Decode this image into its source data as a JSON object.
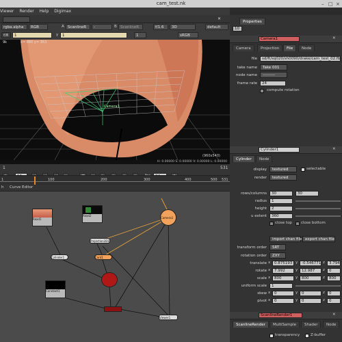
{
  "window": {
    "title": "cam_test.nk"
  },
  "menu": {
    "items": [
      "Viewer",
      "Render",
      "Help",
      "Digimax"
    ]
  },
  "viewer_toolbar": {
    "channels": "rgba.alpha",
    "colorspace": "RGB",
    "input_a": "A",
    "renderer_a": "ScanlineR",
    "dash": "-",
    "input_b": "B",
    "renderer_b": "ScanlineR",
    "gain": "f/1.6",
    "view_mode": "3D",
    "view_default": "default",
    "gamma_label": "y",
    "gamma_value": "1",
    "frame_box": "1",
    "lut": "sRGB"
  },
  "viewer": {
    "info": "x= 880 y= 363",
    "node_label": "Camera1",
    "resolution": "(960x540)",
    "readout": "H: 0.00000 S: 0.00000 V: 0.00000  L: 0.00000",
    "status_prefix": "9k"
  },
  "timeline": {
    "frame": "10",
    "fps_label": "fps",
    "fps": "24",
    "ticks": [
      "1",
      "100",
      "200",
      "300",
      "400",
      "500",
      "531"
    ],
    "start": "1",
    "end": "531"
  },
  "node_graph": {
    "tabs": [
      "h",
      "Curve Editor"
    ],
    "nodes": {
      "read1": "Read1",
      "read2": "Read2",
      "projection": "Projection3D1",
      "camera": "Camera1",
      "card": "Card1",
      "cylinder": "Cylinder1",
      "constant": "Constant1",
      "viewer1": "Viewer1",
      "scanline": "ScanlineRender1"
    }
  },
  "properties": {
    "title": "Properties",
    "count": "10",
    "camera": {
      "name": "Camera1",
      "tabs": [
        "Camera",
        "Projection",
        "File",
        "Node"
      ],
      "file_label": "file",
      "file_value": "sd/ft/sq020/sh0090/drake/cam_test_02.fbx",
      "take_name_label": "take name",
      "take_name": "Take 001",
      "node_name_label": "node name",
      "node_name": "---------",
      "frame_rate_label": "frame rate",
      "frame_rate": "24",
      "compute_rotation": "compute rotation"
    },
    "cylinder": {
      "name": "Cylinder1",
      "tabs": [
        "Cylinder",
        "Node"
      ],
      "display_label": "display",
      "display": "textured",
      "selectable": "selectable",
      "render_label": "render",
      "render": "textured",
      "rows_label": "rows/columns",
      "rows": "30",
      "columns": "30",
      "radius_label": "radius",
      "radius": "1",
      "height_label": "height",
      "height": "2",
      "u_extent_label": "u extent",
      "u_extent": "360",
      "close_top": "close top",
      "close_bottom": "close bottom",
      "import_chan": "import chan file",
      "export_chan": "export chan file",
      "transform_order_label": "transform order",
      "transform_order": "SRT",
      "rotation_order_label": "rotation order",
      "rotation_order": "ZXY",
      "translate_label": "translate",
      "translate": [
        "0.875193",
        "-0.546771",
        "3.794"
      ],
      "rotate_label": "rotate",
      "rotate": [
        "7.992",
        "12.987",
        "0"
      ],
      "scale_label": "scale",
      "scale": [
        "800",
        "800",
        "800"
      ],
      "uniform_scale_label": "uniform scale",
      "uniform_scale": "1",
      "skew_label": "skew",
      "skew": [
        "0",
        "0",
        "0"
      ],
      "pivot_label": "pivot",
      "pivot": [
        "0",
        "0",
        "0"
      ],
      "axes": [
        "x",
        "y",
        "z"
      ]
    },
    "scanline": {
      "name": "ScanlineRender1",
      "tabs": [
        "ScanlineRender",
        "MultiSample",
        "Shader",
        "Node"
      ],
      "transparency": "transparency",
      "zbuffer": "Z-buffer"
    }
  }
}
